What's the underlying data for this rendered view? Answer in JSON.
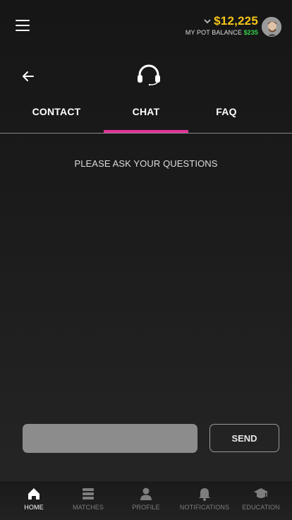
{
  "header": {
    "balance": "$12,225",
    "pot_label": "MY POT BALANCE",
    "pot_value": "$235"
  },
  "tabs": [
    {
      "label": "CONTACT"
    },
    {
      "label": "CHAT"
    },
    {
      "label": "FAQ"
    }
  ],
  "active_tab": "CHAT",
  "chat": {
    "prompt": "PLEASE ASK YOUR QUESTIONS",
    "input_value": "",
    "input_placeholder": "",
    "send_label": "SEND"
  },
  "bottom_nav": {
    "items": [
      {
        "label": "HOME",
        "icon": "home-icon"
      },
      {
        "label": "MATCHES",
        "icon": "matches-icon"
      },
      {
        "label": "PROFILE",
        "icon": "profile-icon"
      },
      {
        "label": "NOTIFICATIONS",
        "icon": "bell-icon"
      },
      {
        "label": "EDUCATION",
        "icon": "graduation-cap-icon"
      }
    ],
    "active": "HOME"
  },
  "colors": {
    "balance": "#f5c518",
    "pot_value": "#35d64a",
    "tab_indicator": "#e0339a",
    "background": "#1a1a1a"
  }
}
